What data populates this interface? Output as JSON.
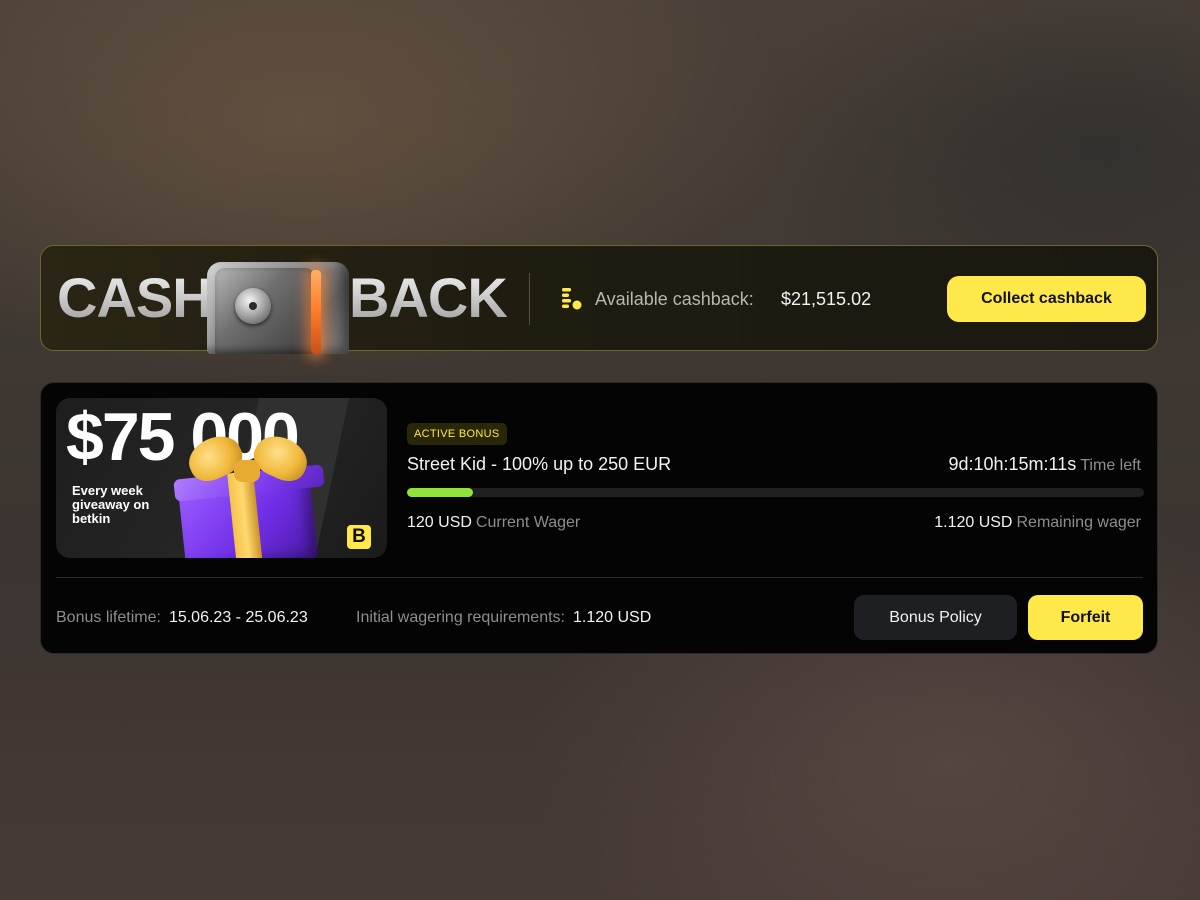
{
  "cashback": {
    "title_left": "CASH",
    "title_right": "BACK",
    "available_label": "Available cashback:",
    "available_value": "$21,515.02",
    "collect_label": "Collect cashback",
    "icon": "coins-icon",
    "safe_icon": "safe-icon"
  },
  "promo": {
    "amount": "$75 000",
    "subtitle": "Every week giveaway on betkin",
    "brand_letter": "B",
    "image": "gift-box-icon"
  },
  "bonus": {
    "badge": "ACTIVE BONUS",
    "title": "Street Kid - 100% up to 250 EUR",
    "timer_value": "9d:10h:15m:11s",
    "timer_label": "Time left",
    "progress_fraction": 0.09,
    "current_wager_value": "120 USD",
    "current_wager_label": "Current Wager",
    "remaining_wager_value": "1.120 USD",
    "remaining_wager_label": "Remaining wager",
    "lifetime_label": "Bonus lifetime:",
    "lifetime_value": "15.06.23 - 25.06.23",
    "initial_label": "Initial wagering requirements:",
    "initial_value": "1.120 USD",
    "policy_label": "Bonus Policy",
    "forfeit_label": "Forfeit"
  },
  "colors": {
    "accent_yellow": "#ffe94a",
    "progress_green": "#8fe33a",
    "gift_purple": "#7d3cf0",
    "safe_glow": "#ff7a2a"
  }
}
